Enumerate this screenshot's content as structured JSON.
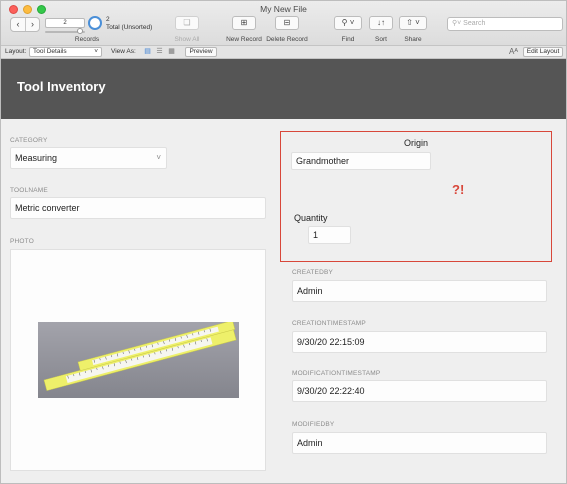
{
  "window": {
    "title": "My New File"
  },
  "toolbar": {
    "record_number": "2",
    "records_label": "Records",
    "found_count": "2",
    "total_label": "Total (Unsorted)",
    "show_all_label": "Show All",
    "new_record_label": "New Record",
    "delete_record_label": "Delete Record",
    "find_label": "Find",
    "sort_label": "Sort",
    "share_label": "Share",
    "search_placeholder": "Search"
  },
  "layout_bar": {
    "layout_label": "Layout:",
    "layout_value": "Tool Details",
    "view_as_label": "View As:",
    "preview_label": "Preview",
    "edit_layout_label": "Edit Layout",
    "font_size_label": "Aᴬ"
  },
  "header": {
    "title": "Tool Inventory"
  },
  "fields": {
    "category": {
      "label": "CATEGORY",
      "value": "Measuring"
    },
    "toolname": {
      "label": "TOOLNAME",
      "value": "Metric converter"
    },
    "photo": {
      "label": "PHOTO"
    },
    "origin": {
      "label": "Origin",
      "value": "Grandmother"
    },
    "alert": "?!",
    "quantity": {
      "label": "Quantity",
      "value": "1"
    },
    "createdby": {
      "label": "CREATEDBY",
      "value": "Admin"
    },
    "creation_timestamp": {
      "label": "CREATIONTIMESTAMP",
      "value": "9/30/20 22:15:09"
    },
    "modification_timestamp": {
      "label": "MODIFICATIONTIMESTAMP",
      "value": "9/30/20 22:22:40"
    },
    "modifiedby": {
      "label": "MODIFIEDBY",
      "value": "Admin"
    }
  },
  "colors": {
    "header_bg": "#555555",
    "alert": "#d8473a",
    "accent": "#4a8fd8"
  }
}
